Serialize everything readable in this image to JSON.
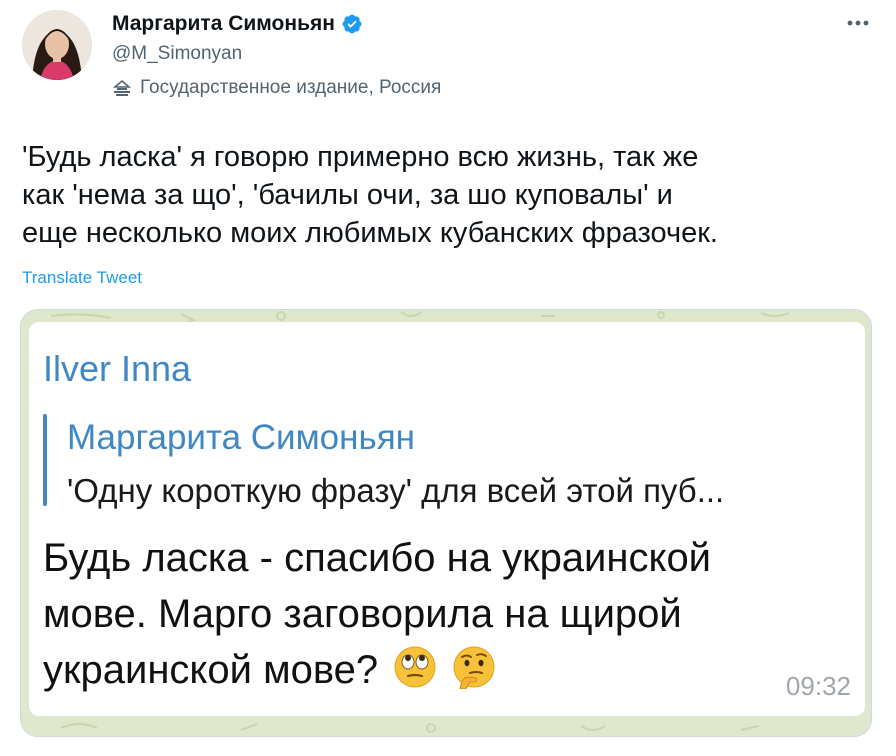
{
  "author": {
    "name": "Маргарита Симоньян",
    "handle": "@M_Simonyan",
    "label": "Государственное издание, Россия"
  },
  "tweet": {
    "lines": [
      "'Будь ласка' я говорю примерно всю жизнь, так же",
      "как 'нема за що', 'бачилы очи, за шо куповалы' и",
      "еще несколько моих любимых кубанских фразочек."
    ],
    "translate": "Translate Tweet"
  },
  "media": {
    "sender": "Ilver Inna",
    "reply_author": "Маргарита Симоньян",
    "reply_text": "'Одну короткую фразу' для всей этой пуб...",
    "message_lines": [
      "Будь ласка - спасибо на украинской",
      "мове. Марго заговорила на щирой",
      "украинской мове?"
    ],
    "emojis": [
      "rolling-eyes-emoji",
      "thinking-face-emoji"
    ],
    "time": "09:32"
  },
  "icons": {
    "verified": "verified-badge-icon",
    "more": "more-icon",
    "gov": "government-label-icon"
  },
  "colors": {
    "link": "#1d9bf0",
    "verified": "#1d9bf0",
    "telegram_accent": "#3f88c5",
    "chat_background": "#dfe8cc"
  }
}
